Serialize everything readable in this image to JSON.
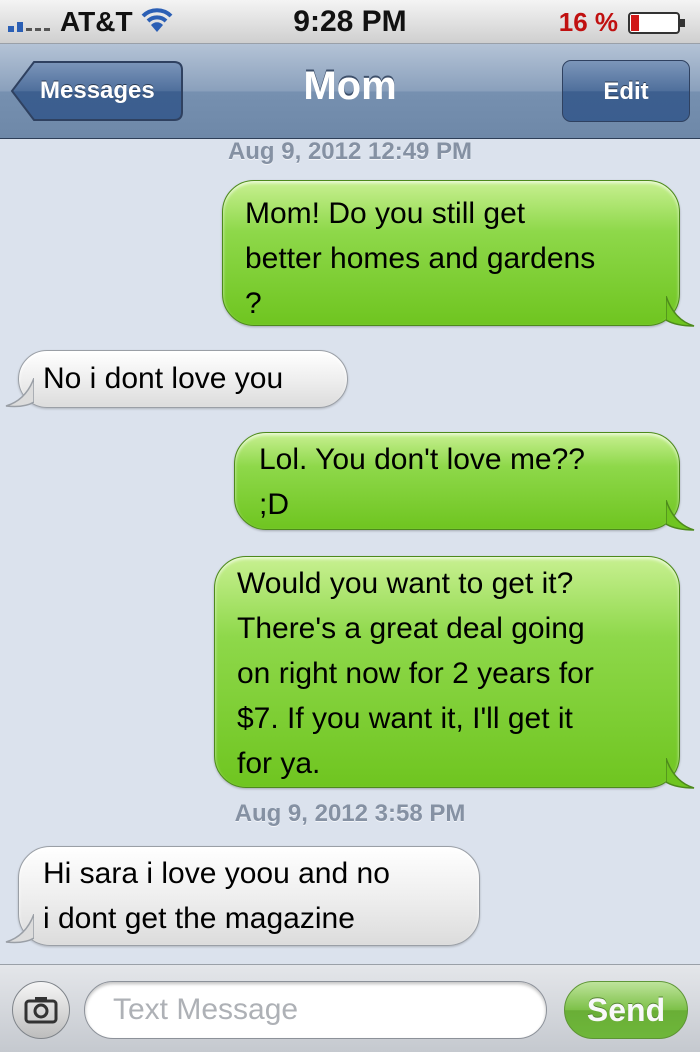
{
  "status_bar": {
    "carrier": "AT&T",
    "time": "9:28 PM",
    "battery": "16 %",
    "battery_color": "#c01010",
    "icons": [
      "signal-icon",
      "wifi-icon",
      "battery-icon"
    ]
  },
  "nav": {
    "back_label": "Messages",
    "title": "Mom",
    "edit_label": "Edit"
  },
  "conversation": {
    "timestamps": [
      "Aug 9, 2012 12:49 PM",
      "Aug 9, 2012 3:58 PM"
    ],
    "messages": [
      {
        "direction": "sent",
        "lines": [
          "Mom! Do you still get",
          "better homes and gardens",
          "?"
        ]
      },
      {
        "direction": "received",
        "lines": [
          "No i dont love you"
        ]
      },
      {
        "direction": "sent",
        "lines": [
          "Lol. You don't love me??",
          ";D"
        ]
      },
      {
        "direction": "sent",
        "lines": [
          "Would you want to get it?",
          "There's a great deal going",
          "on right now for 2 years for",
          "$7. If you want it, I'll get it",
          "for ya."
        ]
      },
      {
        "direction": "received",
        "lines": [
          "Hi sara i love yoou and no",
          "i dont get the magazine"
        ]
      }
    ]
  },
  "input_bar": {
    "placeholder": "Text Message",
    "send_label": "Send",
    "camera_icon": "camera-icon"
  }
}
